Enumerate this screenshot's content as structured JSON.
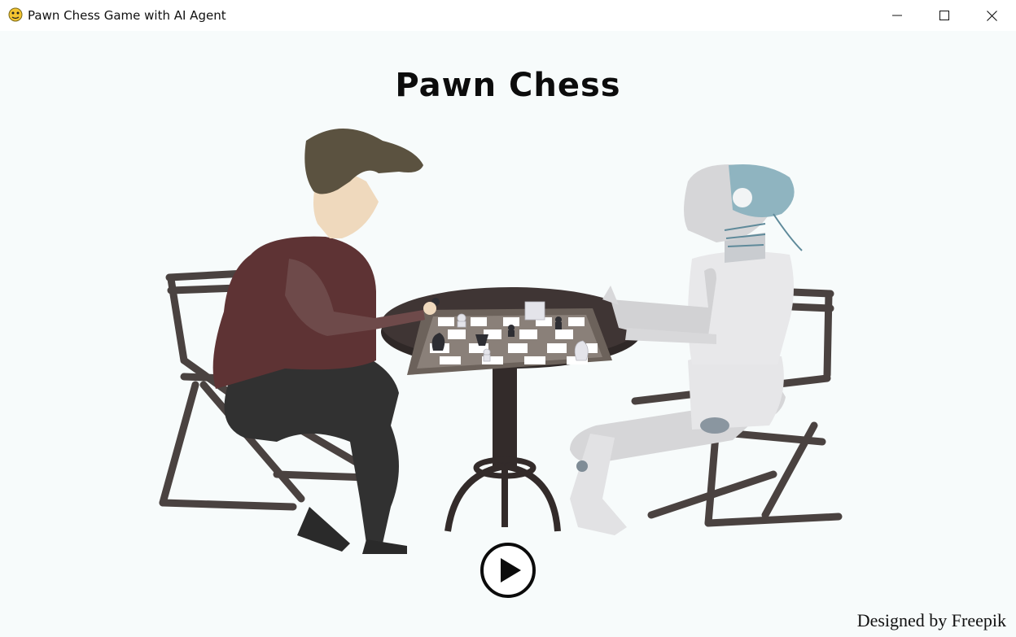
{
  "window": {
    "title": "Pawn Chess Game with AI Agent",
    "app_icon": "pygame-snake-icon",
    "controls": [
      "minimize-icon",
      "maximize-icon",
      "close-icon"
    ]
  },
  "main": {
    "title": "Pawn Chess",
    "illustration": "person-vs-robot-chess-illustration",
    "play_icon": "play-icon",
    "credit": "Designed by Freepik"
  },
  "colors": {
    "background": "#f7fbfb",
    "shirt": "#5e3334",
    "hair": "#5b5240",
    "skin": "#efd9bd",
    "robot": "#dcdcde",
    "robot_brain": "#8fb4c0",
    "chair": "#4a4240",
    "table": "#3f3534"
  }
}
